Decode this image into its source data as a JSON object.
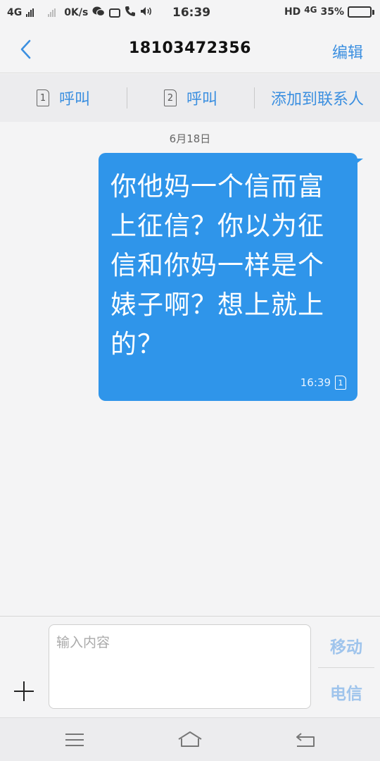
{
  "status_bar": {
    "network_1": "4G",
    "speed": "0K/s",
    "time": "16:39",
    "hd": "HD",
    "network_2": "4G",
    "battery": "35%"
  },
  "header": {
    "title": "18103472356",
    "edit_label": "编辑"
  },
  "actions": {
    "call_1": {
      "sim": "1",
      "label": "呼叫"
    },
    "call_2": {
      "sim": "2",
      "label": "呼叫"
    },
    "add_contact": "添加到联系人"
  },
  "messages": {
    "date": "6月18日",
    "items": [
      {
        "text": "你他妈一个信而富上征信？你以为征信和你妈一样是个婊子啊？想上就上的？",
        "time": "16:39",
        "sim": "1"
      }
    ]
  },
  "composer": {
    "placeholder": "输入内容",
    "send_mobile": "移动",
    "send_telecom": "电信"
  },
  "colors": {
    "accent": "#3b8fe0",
    "bubble": "#2f95ea"
  }
}
